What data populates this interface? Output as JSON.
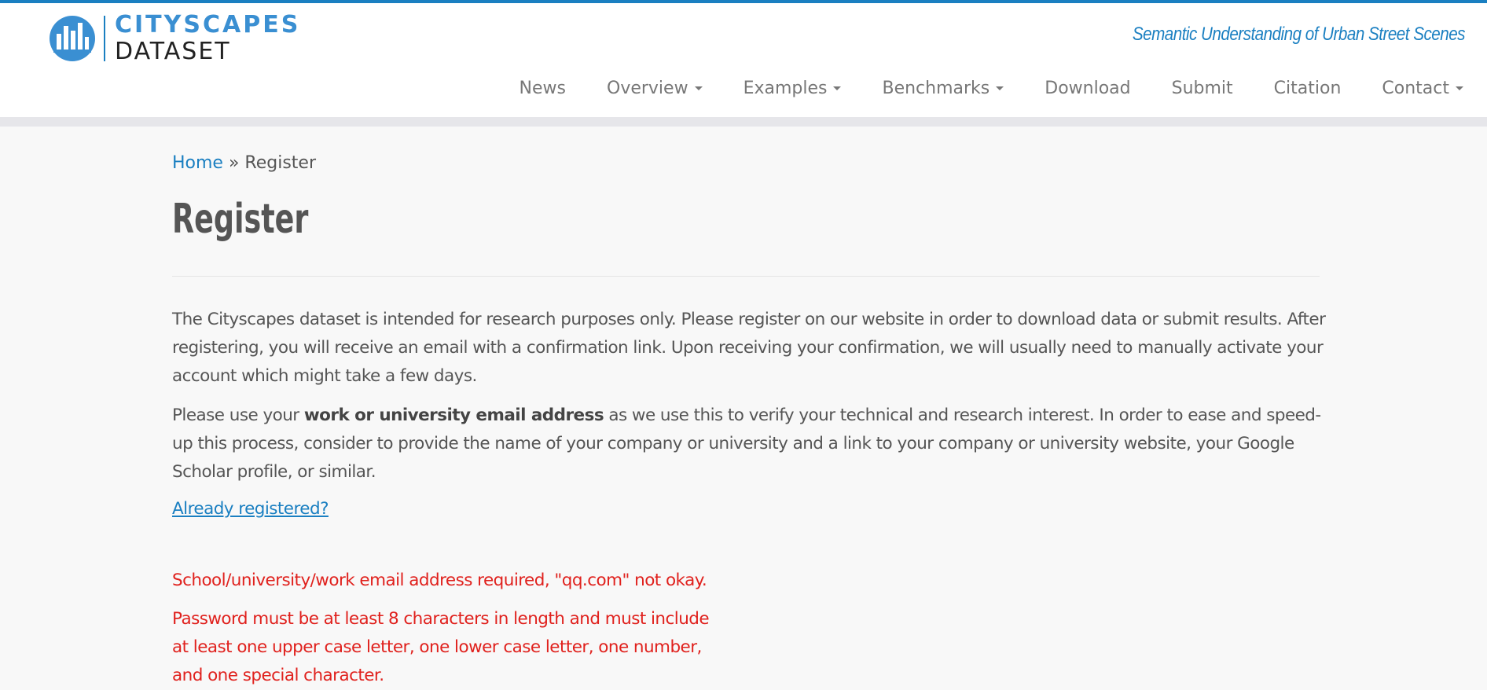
{
  "header": {
    "logo": {
      "line1": "CITYSCAPES",
      "line2": "DATASET"
    },
    "tagline": "Semantic Understanding of Urban Street Scenes",
    "nav": [
      {
        "label": "News",
        "dropdown": false
      },
      {
        "label": "Overview",
        "dropdown": true
      },
      {
        "label": "Examples",
        "dropdown": true
      },
      {
        "label": "Benchmarks",
        "dropdown": true
      },
      {
        "label": "Download",
        "dropdown": false
      },
      {
        "label": "Submit",
        "dropdown": false
      },
      {
        "label": "Citation",
        "dropdown": false
      },
      {
        "label": "Contact",
        "dropdown": true
      }
    ]
  },
  "breadcrumb": {
    "home": "Home",
    "separator": " » ",
    "current": "Register"
  },
  "page": {
    "title": "Register",
    "intro": "The Cityscapes dataset is intended for research purposes only. Please register on our website in order to download data or submit results. After registering, you will receive an email with a confirmation link. Upon receiving your confirmation, we will usually need to manually activate your account which might take a few days.",
    "email_note_before": "Please use your ",
    "email_note_bold": "work or university email address",
    "email_note_after": " as we use this to verify your technical and research interest. In order to ease and speed-up this process, consider to provide the name of your company or university and a link to your company or university website, your Google Scholar profile, or similar.",
    "already_registered": "Already registered?"
  },
  "errors": {
    "email": "School/university/work email address required, \"qq.com\" not okay.",
    "password": "Password must be at least 8 characters in length and must include at least one upper case letter, one lower case letter, one number, and one special character."
  },
  "colors": {
    "brand": "#1a7fc1",
    "error": "#e0211d",
    "text": "#555555"
  }
}
